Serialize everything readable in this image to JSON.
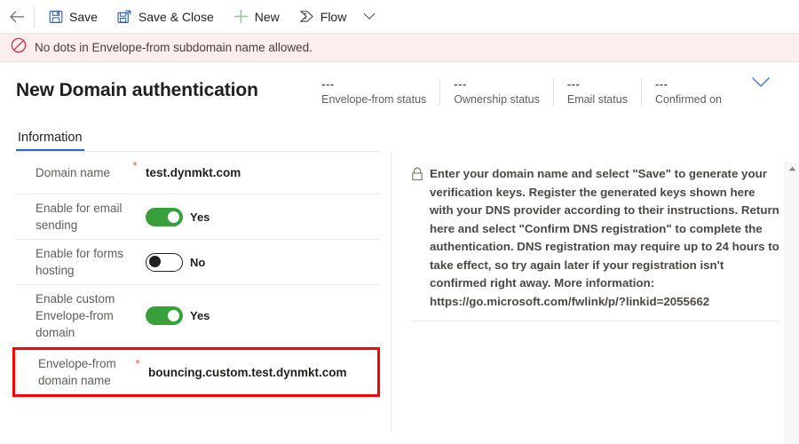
{
  "commandbar": {
    "back_label": "Back",
    "items": [
      {
        "label": "Save",
        "icon": "save-icon"
      },
      {
        "label": "Save & Close",
        "icon": "save-and-close-icon"
      },
      {
        "label": "New",
        "icon": "plus-icon"
      },
      {
        "label": "Flow",
        "icon": "flow-icon"
      }
    ],
    "overflow_label": "More commands"
  },
  "notification": {
    "icon": "blocked-icon",
    "message": "No dots in Envelope-from subdomain name allowed.",
    "background": "#fdeeee"
  },
  "header": {
    "title": "New Domain authentication",
    "statuses": [
      {
        "value": "---",
        "label": "Envelope-from status"
      },
      {
        "value": "---",
        "label": "Ownership status"
      },
      {
        "value": "---",
        "label": "Email status"
      },
      {
        "value": "---",
        "label": "Confirmed on"
      }
    ],
    "expand_icon": "chevron-down-icon"
  },
  "tabs": [
    {
      "label": "Information",
      "active": true
    }
  ],
  "form": {
    "rows": [
      {
        "label": "Domain name",
        "required": "*",
        "type": "text",
        "value": "test.dynmkt.com",
        "highlighted": false
      },
      {
        "label": "Enable for email sending",
        "required": "",
        "type": "toggle",
        "toggle_state": "on",
        "value": "Yes",
        "highlighted": false
      },
      {
        "label": "Enable for forms hosting",
        "required": "",
        "type": "toggle",
        "toggle_state": "off",
        "value": "No",
        "highlighted": false
      },
      {
        "label": "Enable custom Envelope-from domain",
        "required": "",
        "type": "toggle",
        "toggle_state": "on",
        "value": "Yes",
        "highlighted": false
      },
      {
        "label": "Envelope-from domain name",
        "required": "*",
        "type": "text",
        "value": "bouncing.custom.test.dynmkt.com",
        "highlighted": true
      }
    ]
  },
  "info_panel": {
    "icon": "lock-icon",
    "text": "Enter your domain name and select \"Save\" to generate your verification keys. Register the generated keys shown here with your DNS provider according to their instructions. Return here and select \"Confirm DNS registration\" to complete the authentication. DNS registration may require up to 24 hours to take effect, so try again later if your registration isn't confirmed right away. More information: https://go.microsoft.com/fwlink/p/?linkid=2055662"
  },
  "scrollbar": {
    "up_icon": "scroll-up-arrow-icon"
  },
  "colors": {
    "accent": "#2266dd",
    "toggle_on": "#37a03b",
    "error_border": "#ff0000",
    "required_star": "#e8543f",
    "error_icon": "#c4314b"
  }
}
